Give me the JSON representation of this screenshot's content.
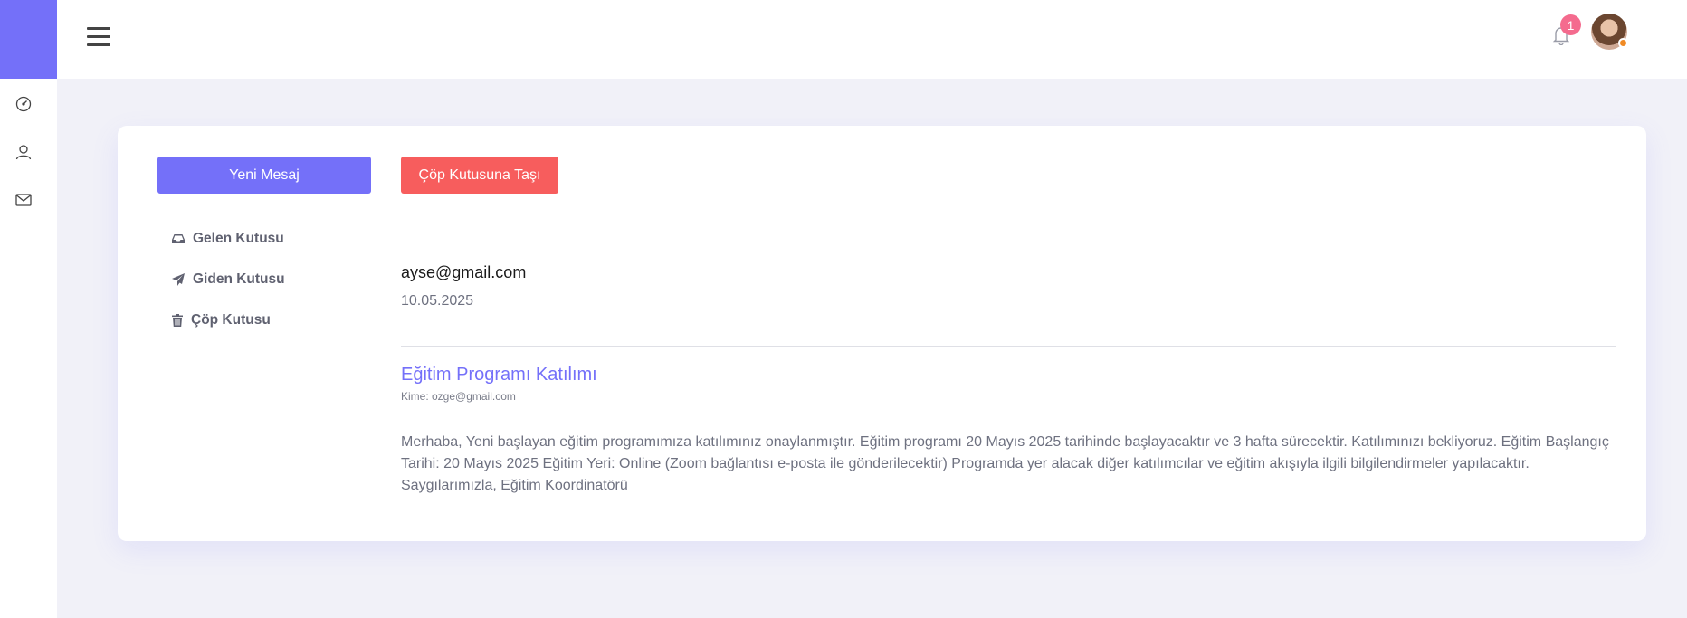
{
  "sidebar": {
    "icons": [
      "speedometer-icon",
      "user-icon",
      "mail-icon"
    ]
  },
  "header": {
    "notification_count": "1",
    "colors": {
      "brand": "#7470f9",
      "badge": "#f46b8e",
      "status_dot": "#f08a24"
    }
  },
  "mail": {
    "new_message_label": "Yeni Mesaj",
    "move_to_trash_label": "Çöp Kutusuna Taşı",
    "folders": [
      {
        "label": "Gelen Kutusu",
        "icon": "inbox-icon"
      },
      {
        "label": "Giden Kutusu",
        "icon": "paper-plane-icon"
      },
      {
        "label": "Çöp Kutusu",
        "icon": "trash-icon"
      }
    ],
    "message": {
      "from": "ayse@gmail.com",
      "date": "10.05.2025",
      "subject": "Eğitim Programı Katılımı",
      "to": "Kime: ozge@gmail.com",
      "body": "Merhaba, Yeni başlayan eğitim programımıza katılımınız onaylanmıştır. Eğitim programı 20 Mayıs 2025 tarihinde başlayacaktır ve 3 hafta sürecektir. Katılımınızı bekliyoruz. Eğitim Başlangıç Tarihi: 20 Mayıs 2025 Eğitim Yeri: Online (Zoom bağlantısı e-posta ile gönderilecektir) Programda yer alacak diğer katılımcılar ve eğitim akışıyla ilgili bilgilendirmeler yapılacaktır. Saygılarımızla, Eğitim Koordinatörü"
    },
    "colors": {
      "new_button": "#7470f9",
      "trash_button": "#f75d5d",
      "subject": "#7470f9"
    }
  }
}
